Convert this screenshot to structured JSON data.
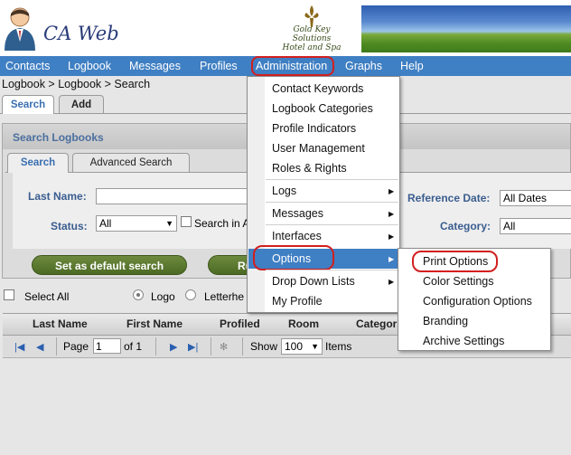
{
  "app": {
    "name": "CA Web",
    "hotel_lines": [
      "Gold Key",
      "Solutions",
      "Hotel and Spa"
    ]
  },
  "nav": {
    "items": [
      "Contacts",
      "Logbook",
      "Messages",
      "Profiles",
      "Administration",
      "Graphs",
      "Help"
    ]
  },
  "breadcrumb": "Logbook > Logbook > Search",
  "tabs": {
    "search": "Search",
    "add": "Add"
  },
  "panel": {
    "title": "Search Logbooks",
    "tabs": {
      "search": "Search",
      "advanced": "Advanced Search"
    },
    "last_name_label": "Last Name:",
    "last_name_value": "",
    "status_label": "Status:",
    "status_value": "All",
    "search_in_label": "Search in A",
    "reference_date_label": "Reference Date:",
    "reference_date_value": "All Dates",
    "category_label": "Category:",
    "category_value": "All",
    "default_search_button": "Set as default search",
    "run_button": "Ru"
  },
  "list": {
    "select_all": "Select All",
    "radio_logo": "Logo",
    "radio_letterhead": "Letterhe"
  },
  "grid": {
    "columns": [
      "Last Name",
      "First Name",
      "Profiled",
      "Room",
      "Categor"
    ],
    "pager": {
      "page_label": "Page",
      "page_value": "1",
      "of_label": "of 1",
      "show_label": "Show",
      "show_value": "100",
      "items_label": "Items"
    }
  },
  "menu": {
    "items": [
      "Contact Keywords",
      "Logbook Categories",
      "Profile Indicators",
      "User Management",
      "Roles & Rights",
      "Logs",
      "Messages",
      "Interfaces",
      "Options",
      "Drop Down Lists",
      "My Profile"
    ]
  },
  "submenu": {
    "items": [
      "Print Options",
      "Color Settings",
      "Configuration Options",
      "Branding",
      "Archive Settings"
    ]
  },
  "colors": {
    "nav": "#3f7fc3",
    "highlight_circle": "#d21f1f",
    "label_blue": "#3a5d8f"
  }
}
